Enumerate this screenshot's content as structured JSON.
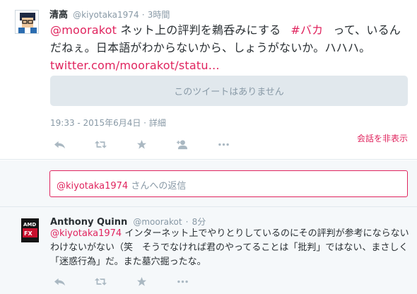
{
  "tweet": {
    "fullname": "清高",
    "username": "@kiyotaka1974",
    "separator": "·",
    "time": "3時間",
    "mention": "@moorakot",
    "text_part1": " ネット上の評判を鵜呑みにする",
    "hashtag": "#バカ",
    "text_part2": "って、いるんだねぇ。日本語がわからないから、しょうがないか。ハハハ。",
    "link": "twitter.com/moorakot/statu…",
    "unavailable": "このツイートはありません",
    "timestamp": "19:33 - 2015年6月4日",
    "details_sep": " · ",
    "details": "詳細",
    "hide_conversation": "会話を非表示",
    "action_icons": [
      "reply-icon",
      "retweet-icon",
      "favorite-icon",
      "follow-icon",
      "more-icon"
    ]
  },
  "reply_box": {
    "mention": "@kiyotaka1974",
    "suffix": " さんへの返信"
  },
  "reply_tweet": {
    "fullname": "Anthony Quinn",
    "username": "@moorakot",
    "separator": "·",
    "time": "8分",
    "mention": "@kiyotaka1974",
    "text": " インターネット上でやりとりしているのにその評判が参考にならないわけないがない（笑　そうでなければ君のやってることは「批判」ではない、まさしく「迷惑行為」だ。また墓穴掘ったな。",
    "action_icons": [
      "reply-icon",
      "retweet-icon",
      "favorite-icon",
      "more-icon"
    ]
  },
  "colors": {
    "accent": "#e0245e",
    "muted": "#8899a6",
    "icon": "#aab8c2",
    "panel": "#f5f8fa",
    "unavailable_bg": "#e1e8ed"
  }
}
